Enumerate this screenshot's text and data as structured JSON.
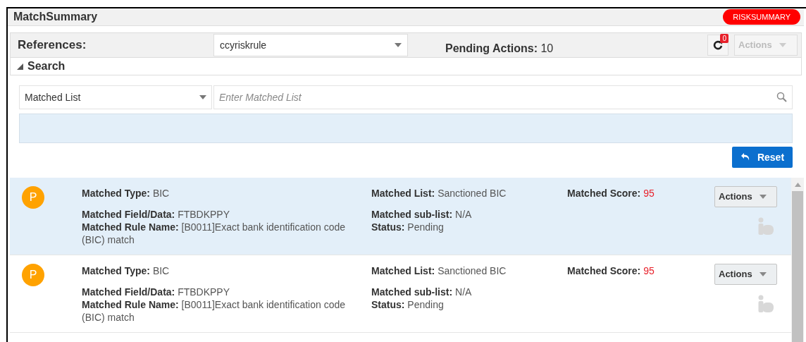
{
  "header": {
    "title": "MatchSummary",
    "risk_button": "RISKSUMMARY"
  },
  "toolbar": {
    "references_label": "References:",
    "references_value": "ccyriskrule",
    "pending_label": "Pending Actions:",
    "pending_value": "10",
    "refresh_badge": "0",
    "actions": {
      "label": "Actions",
      "disabled": true
    }
  },
  "search": {
    "title": "Search",
    "expanded": true,
    "field_select": "Matched List",
    "placeholder": "Enter Matched List",
    "reset": "Reset"
  },
  "results": [
    {
      "selected": true,
      "badge": "P",
      "type": {
        "label": "Matched Type:",
        "value": "BIC"
      },
      "field_data": {
        "label": "Matched Field/Data:",
        "value": "FTBDKPPY"
      },
      "rule_name": {
        "label": "Matched Rule Name:",
        "value": "[B0011]Exact bank identification code (BIC) match"
      },
      "list": {
        "label": "Matched List:",
        "value": "Sanctioned BIC"
      },
      "sub_list": {
        "label": "Matched sub-list:",
        "value": "N/A"
      },
      "status": {
        "label": "Status:",
        "value": "Pending"
      },
      "score": {
        "label": "Matched Score:",
        "value": "95"
      },
      "actions": "Actions"
    },
    {
      "selected": false,
      "badge": "P",
      "type": {
        "label": "Matched Type:",
        "value": "BIC"
      },
      "field_data": {
        "label": "Matched Field/Data:",
        "value": "FTBDKPPY"
      },
      "rule_name": {
        "label": "Matched Rule Name:",
        "value": "[B0011]Exact bank identification code (BIC) match"
      },
      "list": {
        "label": "Matched List:",
        "value": "Sanctioned BIC"
      },
      "sub_list": {
        "label": "Matched sub-list:",
        "value": "N/A"
      },
      "status": {
        "label": "Status:",
        "value": "Pending"
      },
      "score": {
        "label": "Matched Score:",
        "value": "95"
      },
      "actions": "Actions"
    }
  ]
}
